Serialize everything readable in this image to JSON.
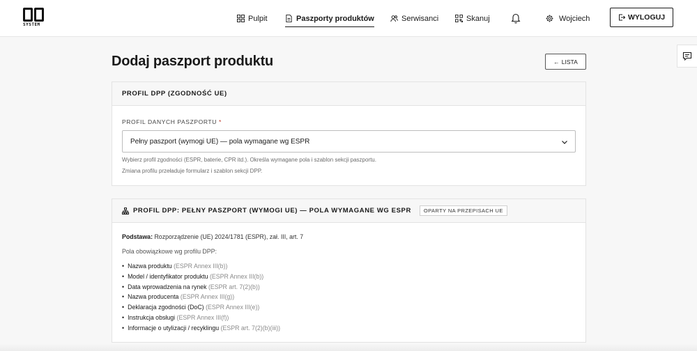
{
  "brand": {
    "logo_text": "SYSTEM"
  },
  "nav": {
    "pulpit": "Pulpit",
    "paszporty": "Paszporty produktów",
    "serwisanci": "Serwisanci",
    "skanuj": "Skanuj",
    "user": "Wojciech",
    "logout": "WYLOGUJ"
  },
  "page": {
    "title": "Dodaj paszport produktu",
    "list_button": "LISTA",
    "list_arrow": "←"
  },
  "profile_card": {
    "header": "PROFIL DPP (ZGODNOŚĆ UE)",
    "field_label": "PROFIL DANYCH PASZPORTU",
    "required_mark": "*",
    "selected": "Pełny paszport (wymogi UE) — pola wymagane wg ESPR",
    "help1": "Wybierz profil zgodności (ESPR, baterie, CPR itd.). Określa wymagane pola i szablon sekcji paszportu.",
    "help2": "Zmiana profilu przeładuje formularz i szablon sekcji DPP."
  },
  "details_card": {
    "header": "PROFIL DPP: PEŁNY PASZPORT (WYMOGI UE) — POLA WYMAGANE WG ESPR",
    "badge": "OPARTY NA PRZEPISACH UE",
    "basis_label": "Podstawa:",
    "basis_value": "Rozporządzenie (UE) 2024/1781 (ESPR), zał. III, art. 7",
    "intro": "Pola obowiązkowe wg profilu DPP:",
    "fields": [
      {
        "name": "Nazwa produktu",
        "ref": "(ESPR Annex III(b))"
      },
      {
        "name": "Model / identyfikator produktu",
        "ref": "(ESPR Annex III(b))"
      },
      {
        "name": "Data wprowadzenia na rynek",
        "ref": "(ESPR art. 7(2)(b))"
      },
      {
        "name": "Nazwa producenta",
        "ref": "(ESPR Annex III(g))"
      },
      {
        "name": "Deklaracja zgodności (DoC)",
        "ref": "(ESPR Annex III(e))"
      },
      {
        "name": "Instrukcja obsługi",
        "ref": "(ESPR Annex III(f))"
      },
      {
        "name": "Informacje o utylizacji / recyklingu",
        "ref": "(ESPR art. 7(2)(b)(iii))"
      }
    ]
  },
  "icons": [
    "grid-icon",
    "document-icon",
    "users-icon",
    "qr-icon",
    "bell-icon",
    "gear-icon",
    "logout-icon",
    "chat-icon",
    "chevron-down-icon",
    "hierarchy-icon"
  ]
}
